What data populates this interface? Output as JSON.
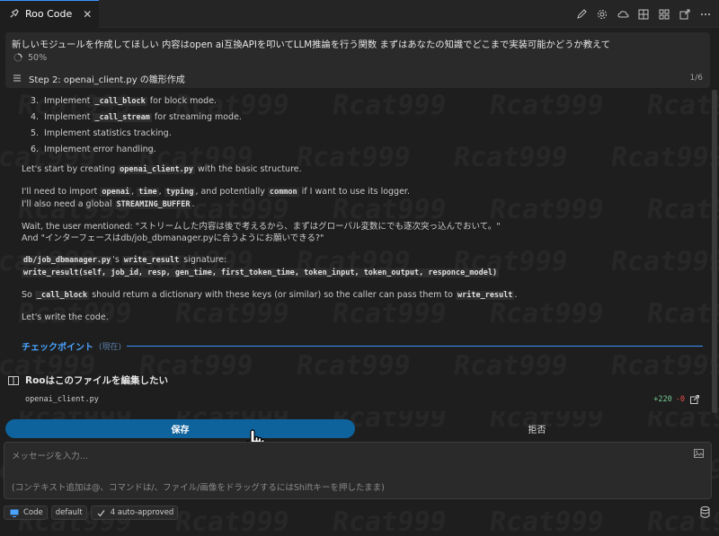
{
  "tab": {
    "title": "Roo Code",
    "close": "✕"
  },
  "toolbar_icons": [
    "pencil-icon",
    "gear-icon",
    "cloud-icon",
    "layout-icon",
    "grid-icon",
    "export-icon",
    "more-icon"
  ],
  "task": {
    "text": "新しいモジュールを作成してほしい 内容はopen ai互換APIを叩いてLLM推論を行う関数 まずはあなたの知識でどこまで実装可能かどうか教えて",
    "progress": "50%",
    "step_title": "Step 2: openai_client.py の雛形作成",
    "step_count": "1/6"
  },
  "content": {
    "items": [
      {
        "num": "3.",
        "pre": "Implement ",
        "code": "_call_block",
        "post": " for block mode."
      },
      {
        "num": "4.",
        "pre": "Implement ",
        "code": "_call_stream",
        "post": " for streaming mode."
      },
      {
        "num": "5.",
        "pre": "Implement statistics tracking.",
        "code": "",
        "post": ""
      },
      {
        "num": "6.",
        "pre": "Implement error handling.",
        "code": "",
        "post": ""
      }
    ],
    "p1_pre": "Let's start by creating ",
    "p1_code": "openai_client.py",
    "p1_post": " with the basic structure.",
    "p2_a": "I'll need to import ",
    "p2_c1": "openai",
    "p2_sep1": ", ",
    "p2_c2": "time",
    "p2_sep2": ", ",
    "p2_c3": "typing",
    "p2_b": ", and potentially ",
    "p2_c4": "common",
    "p2_c": " if I want to use its logger.",
    "p2_line2_pre": "I'll also need a global ",
    "p2_line2_code": "STREAMING_BUFFER",
    "p2_line2_post": ".",
    "p3_line1": "Wait, the user mentioned: \"ストリームした内容は後で考えるから、まずはグローバル変数にでも逐次突っ込んでおいて。\"",
    "p3_line2": "And \"インターフェースはdb/job_dbmanager.pyに合うようにお願いできる?\"",
    "p4_code1": "db/job_dbmanager.py",
    "p4_mid": "'s ",
    "p4_code2": "write_result",
    "p4_post": " signature:",
    "p4_sig": "write_result(self, job_id, resp, gen_time, first_token_time, token_input, token_output, responce_model)",
    "p5_pre": "So ",
    "p5_code1": "_call_block",
    "p5_mid": " should return a dictionary with these keys (or similar) so the caller can pass them to ",
    "p5_code2": "write_result",
    "p5_post": ".",
    "p6": "Let's write the code."
  },
  "checkpoint": {
    "label": "チェックポイント",
    "sub": "(現在)"
  },
  "edit": {
    "title": "Rooはこのファイルを編集したい",
    "file": "openai_client.py",
    "plus": "+220",
    "minus": "-0"
  },
  "buttons": {
    "save": "保存",
    "reject": "拒否"
  },
  "input": {
    "placeholder": "メッセージを入力...",
    "hint": "(コンテキスト追加は@、コマンドは/、ファイル/画像をドラッグするにはShiftキーを押したまま)"
  },
  "bottom": {
    "mode": "Code",
    "profile": "default",
    "approved": "4 auto-approved"
  },
  "watermark": "Rcat999",
  "colors": {
    "accent": "#3794ff",
    "button": "#0e639c",
    "added": "#73c991",
    "removed": "#f14c4c"
  }
}
